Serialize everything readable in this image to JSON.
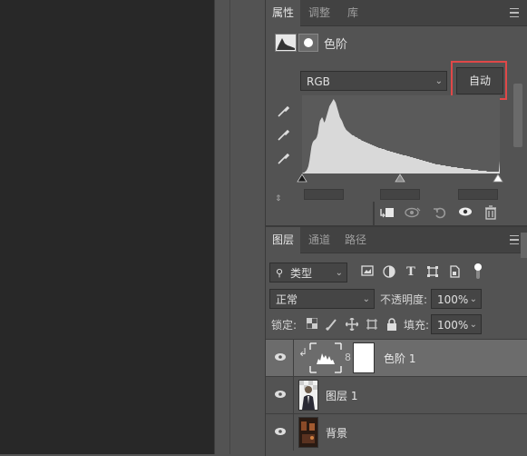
{
  "properties_panel": {
    "tabs": [
      "属性",
      "调整",
      "库"
    ],
    "active_tab": "属性",
    "title": "色阶",
    "channel_select": "RGB",
    "auto_button": "自动"
  },
  "layers_panel": {
    "tabs": [
      "图层",
      "通道",
      "路径"
    ],
    "active_tab": "图层",
    "filter_select": "类型",
    "blend_mode": "正常",
    "opacity_label": "不透明度:",
    "opacity_value": "100%",
    "lock_label": "锁定:",
    "fill_label": "填充:",
    "fill_value": "100%",
    "layers": [
      {
        "name": "色阶 1",
        "visible": true,
        "selected": true
      },
      {
        "name": "图层 1",
        "visible": true,
        "selected": false
      },
      {
        "name": "背景",
        "visible": true,
        "selected": false
      }
    ]
  },
  "colors": {
    "highlight_box": "#e04848",
    "panel_bg": "#535353",
    "canvas_bg": "#282828"
  },
  "histogram": [
    0,
    1,
    1,
    2,
    3,
    5,
    8,
    14,
    22,
    30,
    34,
    36,
    37,
    38,
    40,
    44,
    52,
    58,
    60,
    62,
    60,
    56,
    58,
    62,
    66,
    70,
    74,
    76,
    78,
    80,
    82,
    80,
    78,
    74,
    70,
    66,
    62,
    60,
    58,
    55,
    52,
    50,
    48,
    47,
    46,
    45,
    44,
    43,
    42,
    42,
    41,
    40,
    40,
    39,
    38,
    38,
    37,
    36,
    36,
    35,
    35,
    34,
    34,
    33,
    33,
    32,
    32,
    31,
    31,
    30,
    30,
    29,
    29,
    28,
    28,
    28,
    27,
    27,
    27,
    26,
    26,
    25,
    25,
    25,
    24,
    24,
    24,
    23,
    23,
    23,
    22,
    22,
    22,
    21,
    21,
    21,
    20,
    20,
    20,
    20,
    19,
    19,
    19,
    18,
    18,
    18,
    17,
    17,
    17,
    16,
    16,
    16,
    15,
    15,
    15,
    14,
    14,
    14,
    13,
    13,
    13,
    12,
    12,
    12,
    11,
    11,
    11,
    10,
    10,
    10,
    10,
    10,
    9,
    9,
    9,
    9,
    9,
    8,
    8,
    8,
    8,
    8,
    7,
    7,
    7,
    7,
    7,
    7,
    6,
    6,
    6,
    6,
    6,
    6,
    5,
    5,
    5,
    5,
    5,
    5,
    5,
    4,
    4,
    4,
    4,
    4,
    4,
    4,
    3,
    3,
    3,
    3,
    3,
    3,
    3,
    3,
    2,
    2,
    2,
    2,
    2,
    2,
    2,
    2,
    2,
    2,
    2,
    2,
    14
  ]
}
